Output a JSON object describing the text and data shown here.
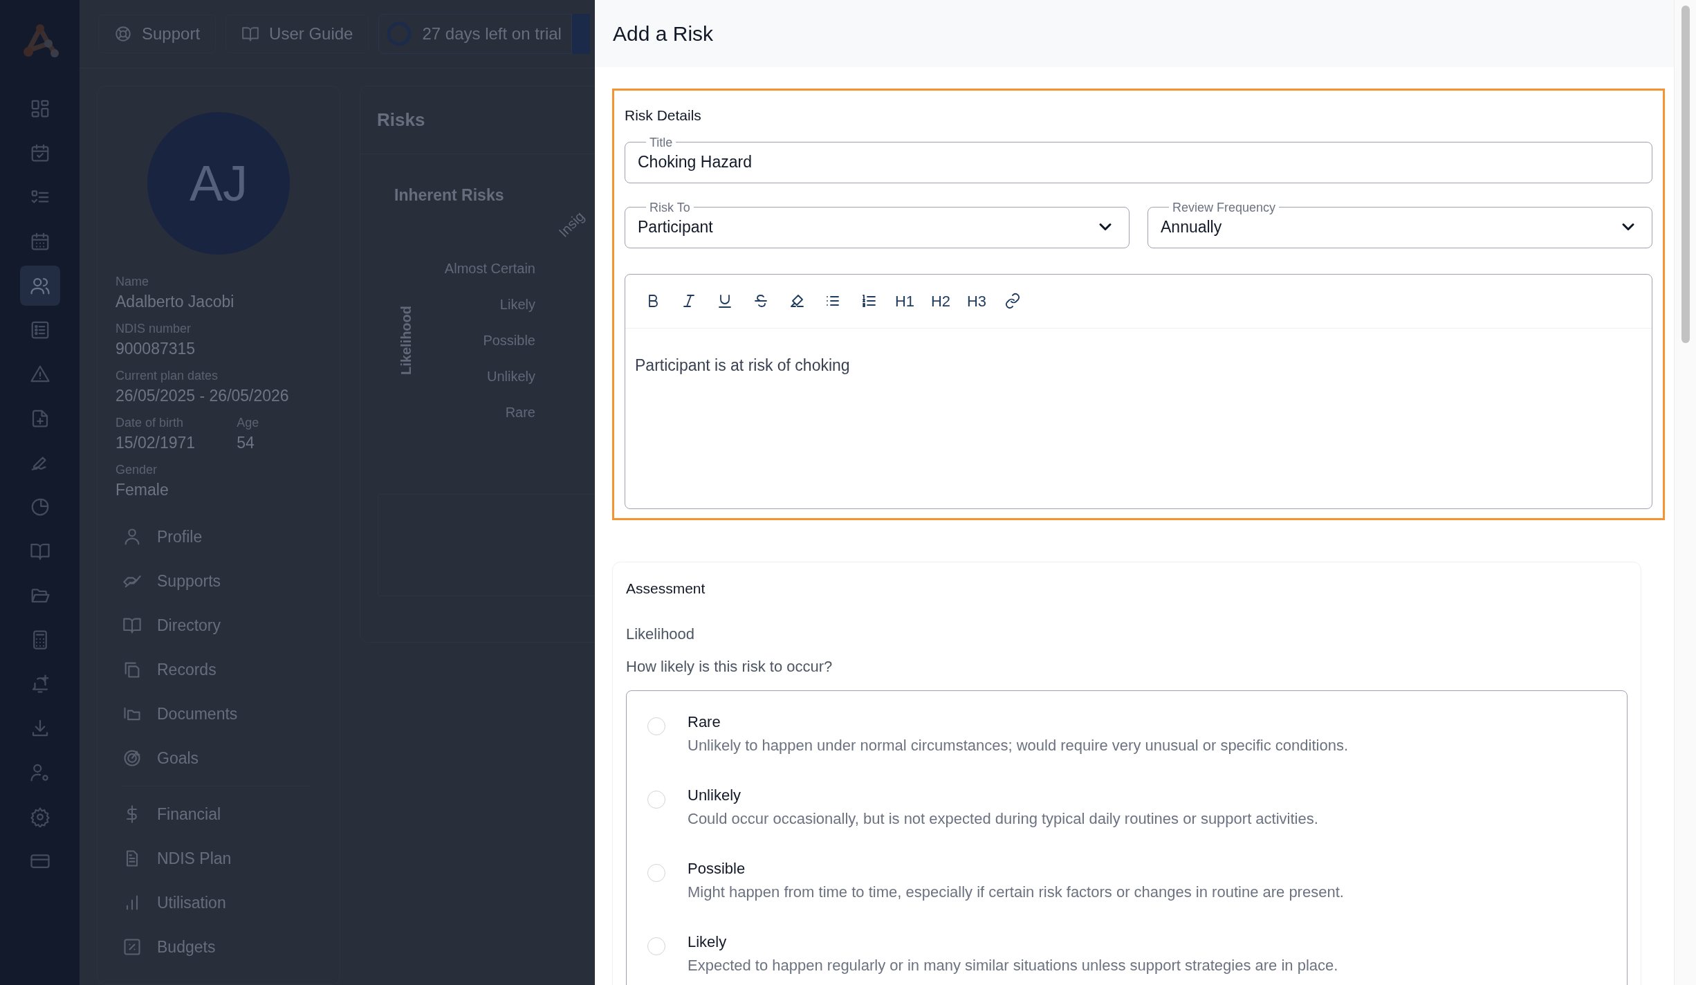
{
  "rail": {
    "items": [
      {
        "kind": "grid",
        "selected": false
      },
      {
        "kind": "calcheck",
        "selected": false
      },
      {
        "kind": "checklist",
        "selected": false
      },
      {
        "kind": "calendar",
        "selected": false
      },
      {
        "kind": "users",
        "selected": true
      },
      {
        "kind": "form",
        "selected": false
      },
      {
        "kind": "warning",
        "selected": false
      },
      {
        "kind": "fileplus",
        "selected": false
      },
      {
        "kind": "signature",
        "selected": false
      },
      {
        "kind": "pie",
        "selected": false
      },
      {
        "kind": "book",
        "selected": false
      },
      {
        "kind": "folder",
        "selected": false
      },
      {
        "kind": "calculator",
        "selected": false
      },
      {
        "kind": "bellplus",
        "selected": false
      },
      {
        "kind": "download",
        "selected": false
      },
      {
        "kind": "usergear",
        "selected": false
      },
      {
        "kind": "gear",
        "selected": false
      },
      {
        "kind": "card",
        "selected": false
      }
    ]
  },
  "top_bar": {
    "buttons": [
      {
        "kind": "lifebuoy",
        "label": "Support"
      },
      {
        "kind": "book",
        "label": "User Guide"
      }
    ],
    "trial": {
      "label": "27 days left on trial"
    }
  },
  "profile": {
    "initials": "AJ",
    "rows": [
      [
        {
          "label": "Name",
          "value": "Adalberto Jacobi"
        }
      ],
      [
        {
          "label": "NDIS number",
          "value": "900087315"
        }
      ],
      [
        {
          "label": "Current plan dates",
          "value": "26/05/2025 - 26/05/2026"
        }
      ],
      [
        {
          "label": "Date of birth",
          "value": "15/02/1971"
        },
        {
          "label": "Age",
          "value": "54"
        }
      ],
      [
        {
          "label": "Gender",
          "value": "Female"
        }
      ]
    ],
    "nav_groups": [
      [
        {
          "kind": "person",
          "label": "Profile"
        },
        {
          "kind": "hands",
          "label": "Supports"
        },
        {
          "kind": "book",
          "label": "Directory"
        },
        {
          "kind": "copy",
          "label": "Records"
        },
        {
          "kind": "folders",
          "label": "Documents"
        },
        {
          "kind": "target",
          "label": "Goals"
        }
      ],
      [
        {
          "kind": "dollar",
          "label": "Financial"
        },
        {
          "kind": "doc",
          "label": "NDIS Plan"
        },
        {
          "kind": "bars",
          "label": "Utilisation"
        },
        {
          "kind": "percent",
          "label": "Budgets"
        }
      ]
    ]
  },
  "risks": {
    "title": "Risks",
    "matrix": {
      "title": "Inherent Risks",
      "y_axis": "Likelihood",
      "x_axis_partial": "Insig",
      "levels": [
        "Almost Certain",
        "Likely",
        "Possible",
        "Unlikely",
        "Rare"
      ]
    }
  },
  "drawer": {
    "title": "Add a Risk",
    "risk_details": {
      "heading": "Risk Details",
      "highlighted": true,
      "title_field": {
        "label": "Title",
        "value": "Choking Hazard"
      },
      "selects": [
        {
          "label": "Risk To",
          "value": "Participant"
        },
        {
          "label": "Review Frequency",
          "value": "Annually"
        }
      ],
      "editor": {
        "tools": [
          {
            "kind": "bold"
          },
          {
            "kind": "italic"
          },
          {
            "kind": "underline"
          },
          {
            "kind": "strike"
          },
          {
            "kind": "highlight"
          },
          {
            "kind": "bullet"
          },
          {
            "kind": "ordered"
          },
          {
            "kind": "heading",
            "label": "H1"
          },
          {
            "kind": "heading",
            "label": "H2"
          },
          {
            "kind": "heading",
            "label": "H3"
          },
          {
            "kind": "link"
          }
        ],
        "content": "Participant is at risk of choking"
      }
    },
    "assessment": {
      "heading": "Assessment",
      "label": "Likelihood",
      "question": "How likely is this risk to occur?",
      "options": [
        {
          "title": "Rare",
          "description": "Unlikely to happen under normal circumstances; would require very unusual or specific conditions.",
          "selected": false
        },
        {
          "title": "Unlikely",
          "description": "Could occur occasionally, but is not expected during typical daily routines or support activities.",
          "selected": false
        },
        {
          "title": "Possible",
          "description": "Might happen from time to time, especially if certain risk factors or changes in routine are present.",
          "selected": false
        },
        {
          "title": "Likely",
          "description": "Expected to happen regularly or in many similar situations unless support strategies are in place.",
          "selected": false
        }
      ]
    }
  }
}
